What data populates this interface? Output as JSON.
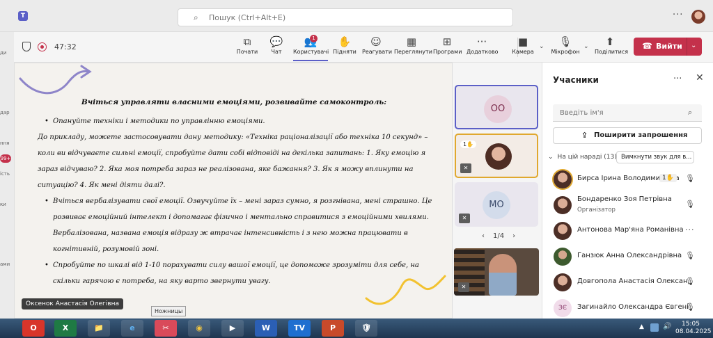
{
  "topbar": {
    "search_placeholder": "Пошук (Ctrl+Alt+E)",
    "more_label": "···"
  },
  "left_rail": {
    "labels": [
      "ди",
      "дар",
      "ння",
      "ість",
      "ки",
      "ами"
    ],
    "badge": "99+"
  },
  "meeting_toolbar": {
    "timer": "47:32",
    "buttons": [
      {
        "label": "Почати",
        "icon": "⧉"
      },
      {
        "label": "Чат",
        "icon": "💬"
      },
      {
        "label": "Користувачі",
        "icon": "👥",
        "badge": "1"
      },
      {
        "label": "Підняти",
        "icon": "✋"
      },
      {
        "label": "Реагувати",
        "icon": "☺"
      },
      {
        "label": "Переглянути",
        "icon": "▦"
      },
      {
        "label": "Програми",
        "icon": "⊞"
      },
      {
        "label": "Додатково",
        "icon": "···"
      },
      {
        "label": "Камера",
        "icon": "■"
      },
      {
        "label": "Мікрофон",
        "icon": "🎙"
      },
      {
        "label": "Поділитися",
        "icon": "⬆"
      }
    ],
    "leave_label": "Вийти"
  },
  "content": {
    "title": "Вчіться управляти власними емоціями, розвивайте самоконтроль:",
    "lines": [
      {
        "bullet": true,
        "text": "Опануйте техніки і методики по управлінню емоціями."
      },
      {
        "bullet": false,
        "text": "До прикладу, можете застосовувати дану методику: «Техніка раціоналізації або техніка 10 секунд» – коли ви відчуваєте сильні емоції, спробуйте дати собі відповіді на декілька запитань: 1. Яку емоцію я зараз відчуваю? 2. Яка моя потреба зараз не реалізована, яке бажання? 3. Як я можу вплинути на ситуацію? 4. Як мені діяти далі?."
      },
      {
        "bullet": true,
        "text": "Вчіться вербалізувати свої емоції. Озвучуйте їх – мені зараз сумно, я розгнівана, мені страшно. Це розвиває емоційний інтелект і допомагає фізично і ментально справитися з емоційними хвилями. Вербалізована, названа емоція відразу ж втрачає інтенсивність і з нею можна працювати в когнітивній, розумовій зоні."
      },
      {
        "bullet": true,
        "text": "Спробуйте по шкалі від 1-10 порахувати силу вашої емоції, це допоможе зрозуміти для себе, на скільки гарячою є потреба, на яку варто звернути увагу."
      }
    ],
    "presenter_name": "Оксенок Анастасія Олегівна",
    "tooltip": "Ножницы"
  },
  "tiles": {
    "tile1_initials": "OO",
    "tile2_hand": "1✋",
    "tile3_initials": "MO",
    "pager": "1/4",
    "prev": "‹",
    "next": "›"
  },
  "participants_panel": {
    "title": "Учасники",
    "name_placeholder": "Введіть ім'я",
    "share_label": "Поширити запрошення",
    "group_label": "На цій нараді (13)",
    "mute_all_label": "Вимкнути звук для в...",
    "people": [
      {
        "name": "Бирса Ірина Володимирівна",
        "hand": "1✋",
        "role": ""
      },
      {
        "name": "Бондаренко Зоя Петрівна",
        "role": "Організатор"
      },
      {
        "name": "Антонова Мар'яна Романівна",
        "role": ""
      },
      {
        "name": "Ганзюк Анна Олександрівна",
        "role": ""
      },
      {
        "name": "Довгопола Анастасія Олександрівна",
        "role": ""
      },
      {
        "name": "Загинайло Олександра Євгенівна",
        "initials": "ЗЄ",
        "role": ""
      }
    ]
  },
  "taskbar": {
    "apps": [
      "O",
      "X",
      "📁",
      "e",
      "✂",
      "◉",
      "▶",
      "W",
      "TV",
      "P",
      "🛡"
    ],
    "time": "15:05",
    "date": "08.04.2025"
  },
  "colors": {
    "accent": "#5b5fc7",
    "leave": "#c4314b",
    "raised_hand": "#e0a82e"
  }
}
